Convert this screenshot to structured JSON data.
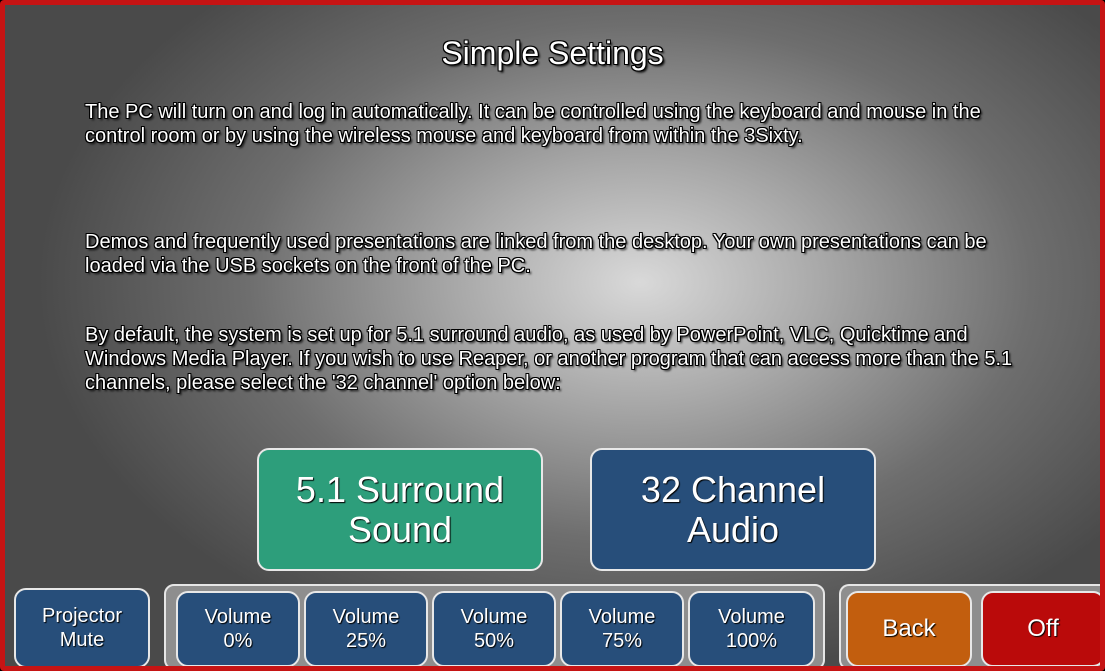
{
  "page": {
    "title": "Simple Settings",
    "paragraphs": [
      "The PC will turn on and log in automatically.  It can be controlled using the keyboard and mouse in the control room or by using the wireless mouse and keyboard from within the 3Sixty.",
      "Demos and frequently used presentations are linked from the desktop.  Your own presentations can be loaded via the USB sockets on the front of the PC.",
      "By default, the system is set up for 5.1 surround audio, as used by PowerPoint, VLC, Quicktime and Windows Media Player.  If you wish to use Reaper, or another program that can access more than the 5.1 channels, please select the '32 channel' option below:"
    ]
  },
  "audio_mode": {
    "surround": {
      "line1": "5.1 Surround",
      "line2": "Sound",
      "selected": true,
      "color": "#2d9e7b"
    },
    "channel32": {
      "line1": "32 Channel",
      "line2": "Audio",
      "selected": false,
      "color": "#274e7a"
    }
  },
  "bottom_bar": {
    "projector_mute": {
      "line1": "Projector",
      "line2": "Mute"
    },
    "volume": [
      {
        "line1": "Volume",
        "line2": "0%"
      },
      {
        "line1": "Volume",
        "line2": "25%"
      },
      {
        "line1": "Volume",
        "line2": "50%"
      },
      {
        "line1": "Volume",
        "line2": "75%"
      },
      {
        "line1": "Volume",
        "line2": "100%"
      }
    ],
    "back": "Back",
    "off": "Off"
  },
  "colors": {
    "frame_border": "#c61414",
    "button_blue": "#274e7a",
    "button_green": "#2d9e7b",
    "back_orange": "#c25e0e",
    "off_red": "#ba0a0a"
  }
}
